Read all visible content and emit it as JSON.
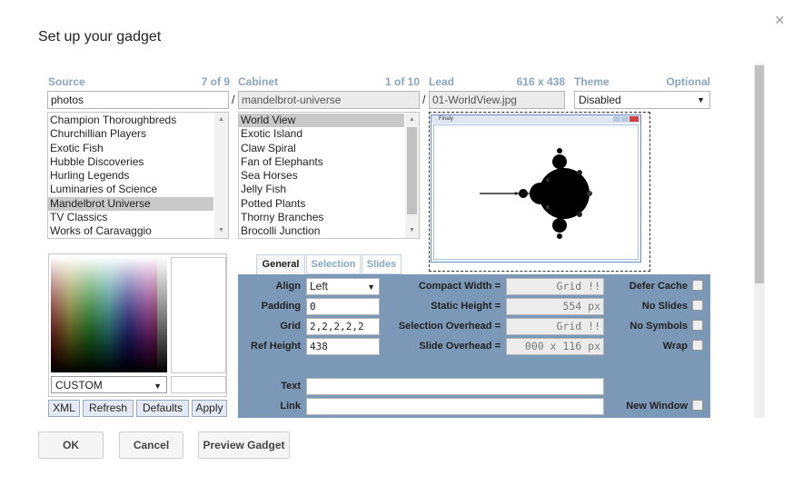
{
  "dialog": {
    "title": "Set up your gadget",
    "close_glyph": "×"
  },
  "source": {
    "label": "Source",
    "count": "7 of 9",
    "value": "photos",
    "items": [
      "Champion Thoroughbreds",
      "Churchillian Players",
      "Exotic Fish",
      "Hubble Discoveries",
      "Hurling Legends",
      "Luminaries of Science",
      "Mandelbrot Universe",
      "TV Classics",
      "Works of Caravaggio"
    ],
    "selected": "Mandelbrot Universe"
  },
  "cabinet": {
    "label": "Cabinet",
    "count": "1 of 10",
    "value": "mandelbrot-universe",
    "items": [
      "World View",
      "Exotic Island",
      "Claw Spiral",
      "Fan of Elephants",
      "Sea Horses",
      "Jelly Fish",
      "Potted Plants",
      "Thorny Branches",
      "Brocolli Junction"
    ],
    "selected": "World View"
  },
  "lead": {
    "label": "Lead",
    "dims": "616 x 438",
    "value": "01-WorldView.jpg",
    "window_caption": "Finaly"
  },
  "theme": {
    "label": "Theme",
    "optional": "Optional",
    "value": "Disabled"
  },
  "separator": "/",
  "color_picker": {
    "preset": "CUSTOM"
  },
  "side_buttons": {
    "xml": "XML",
    "refresh": "Refresh",
    "defaults": "Defaults",
    "apply": "Apply"
  },
  "tabs": {
    "general": "General",
    "selection": "Selection",
    "slides": "Slides",
    "active": "General"
  },
  "general": {
    "align_label": "Align",
    "align_value": "Left",
    "padding_label": "Padding",
    "padding_value": "0",
    "grid_label": "Grid",
    "grid_value": "2,2,2,2,2",
    "ref_height_label": "Ref Height",
    "ref_height_value": "438",
    "compact_width_label": "Compact Width =",
    "compact_width_value": "Grid !!",
    "static_height_label": "Static Height =",
    "static_height_value": "554 px",
    "selection_overhead_label": "Selection Overhead =",
    "selection_overhead_value": "Grid !!",
    "slide_overhead_label": "Slide Overhead =",
    "slide_overhead_value": "000 x 116 px",
    "defer_cache_label": "Defer Cache",
    "no_slides_label": "No Slides",
    "no_symbols_label": "No Symbols",
    "wrap_label": "Wrap",
    "text_label": "Text",
    "text_value": "",
    "link_label": "Link",
    "link_value": "",
    "new_window_label": "New Window"
  },
  "footer": {
    "ok": "OK",
    "cancel": "Cancel",
    "preview": "Preview Gadget"
  },
  "colors": {
    "header_blue": "#8aa5c0",
    "panel_blue": "#7b98b6",
    "selected_gray": "#c9c9c9"
  }
}
